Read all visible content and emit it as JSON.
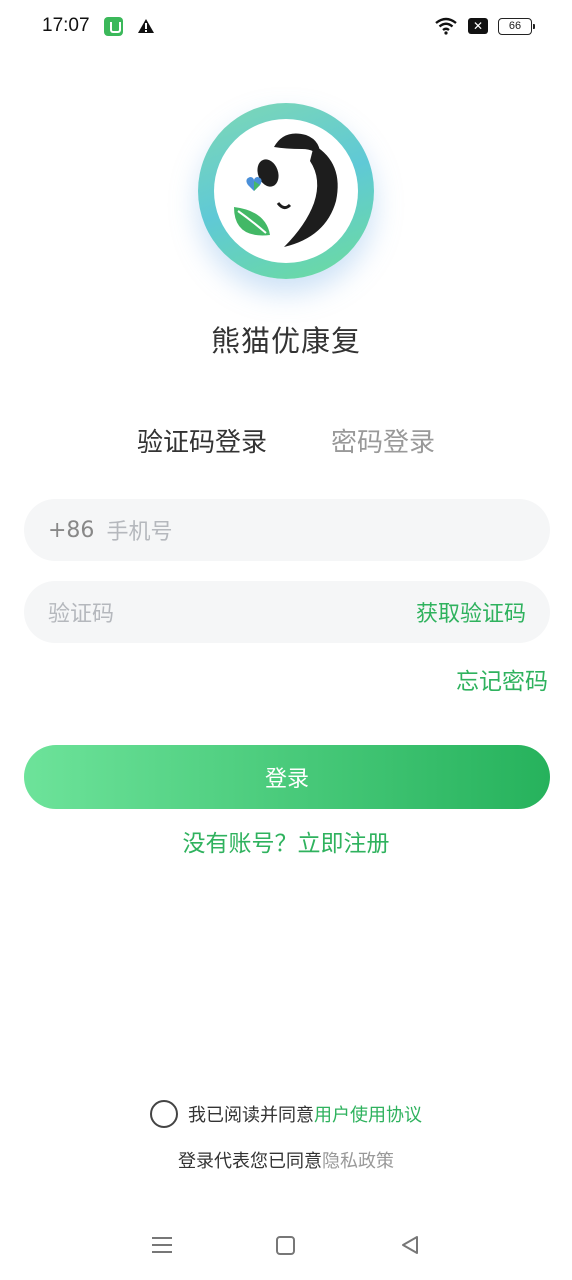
{
  "status_bar": {
    "time": "17:07",
    "battery_level": "66",
    "icons": [
      "app-notification-icon",
      "warning-icon",
      "wifi-icon",
      "no-sim-icon",
      "battery-icon"
    ]
  },
  "app": {
    "name": "熊猫优康复",
    "logo_icon": "panda-logo-icon"
  },
  "tabs": [
    {
      "label": "验证码登录",
      "active": true
    },
    {
      "label": "密码登录",
      "active": false
    }
  ],
  "phone_field": {
    "prefix": "+86",
    "placeholder": "手机号"
  },
  "code_field": {
    "placeholder": "验证码",
    "get_code_label": "获取验证码"
  },
  "forgot_password": "忘记密码",
  "login_button": "登录",
  "register_link": "没有账号？立即注册",
  "agreement": {
    "prefix": "我已阅读并同意",
    "link": "用户使用协议",
    "checked": false
  },
  "privacy": {
    "prefix": "登录代表您已同意",
    "link": "隐私政策"
  },
  "nav_bar": {
    "icons": [
      "menu-icon",
      "home-icon",
      "back-icon"
    ]
  },
  "colors": {
    "accent": "#2fb25e",
    "button_start": "#6de39a",
    "button_end": "#26b25c"
  }
}
